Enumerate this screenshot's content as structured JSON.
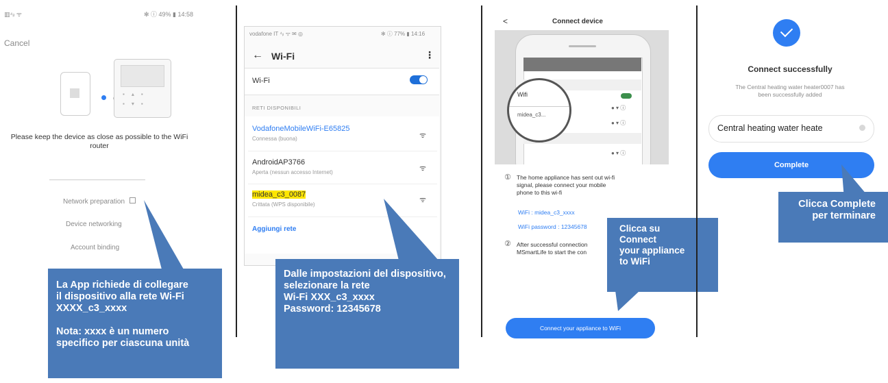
{
  "panel1": {
    "status_left": "▥⁴ᵢₗ ᯤ",
    "status_right": "✻ ⓘ 49% ▮ 14:58",
    "cancel_label": "Cancel",
    "instruction": "Please keep the device as close as possible to the WiFi router",
    "steps": [
      "Network preparation",
      "Device networking",
      "Account binding"
    ],
    "callout_lines": [
      "La App richiede di collegare",
      "il dispositivo alla rete Wi-Fi",
      "XXXX_c3_xxxx",
      "",
      "Nota: xxxx è un numero",
      "specifico per ciascuna unità"
    ]
  },
  "panel2": {
    "status_left": "vodafone IT ⁴ᵢₗ ᯤ ✉ ◎",
    "status_right": "✻ ⓘ 77% ▮ 14:16",
    "title": "Wi-Fi",
    "wifi_label": "Wi-Fi",
    "wifi_on": true,
    "section_label": "RETI DISPONIBILI",
    "networks": [
      {
        "name": "VodafoneMobileWiFi-E65825",
        "status": "Connessa (buona)",
        "highlight": "blue"
      },
      {
        "name": "AndroidAP3766",
        "status": "Aperta (nessun accesso Internet)",
        "highlight": "none"
      },
      {
        "name": "midea_c3_0087",
        "status": "Crittata (WPS disponibile)",
        "highlight": "yellow"
      }
    ],
    "add_network": "Aggiungi rete",
    "callout_lines": [
      "Dalle impostazioni del dispositivo,",
      "selezionare la rete",
      "Wi-Fi XXX_c3_xxxx",
      "Password: 12345678"
    ]
  },
  "panel3": {
    "back_label": "<",
    "title": "Connect device",
    "mock_header": "Wifi",
    "mock_item": "midea_c3...",
    "step1_num": "①",
    "step1_text": [
      "The home appliance has sent out wi-fi",
      "signal, please connect your mobile",
      "phone to this wi-fi"
    ],
    "wifi_line": "WiFi : midea_c3_xxxx",
    "password_line": "WiFi password : 12345678",
    "step2_num": "②",
    "step2_text": [
      "After successful connection",
      "MSmartLife to start the con"
    ],
    "button_label": "Connect your appliance to WiFi",
    "callout_lines": [
      "Clicca su",
      "Connect",
      "your appliance",
      "to WiFi"
    ]
  },
  "panel4": {
    "title": "Connect successfully",
    "subtitle_lines": [
      "The Central heating water heater0007 has",
      "been successfully added"
    ],
    "name_value": "Central heating water heate",
    "button_label": "Complete",
    "callout_lines": [
      "Clicca Complete",
      "per terminare"
    ]
  },
  "colors": {
    "accent": "#2f7ef2",
    "callout": "#4a7ab8",
    "highlight": "#ffe600",
    "toggle": "#1e6fd9"
  }
}
